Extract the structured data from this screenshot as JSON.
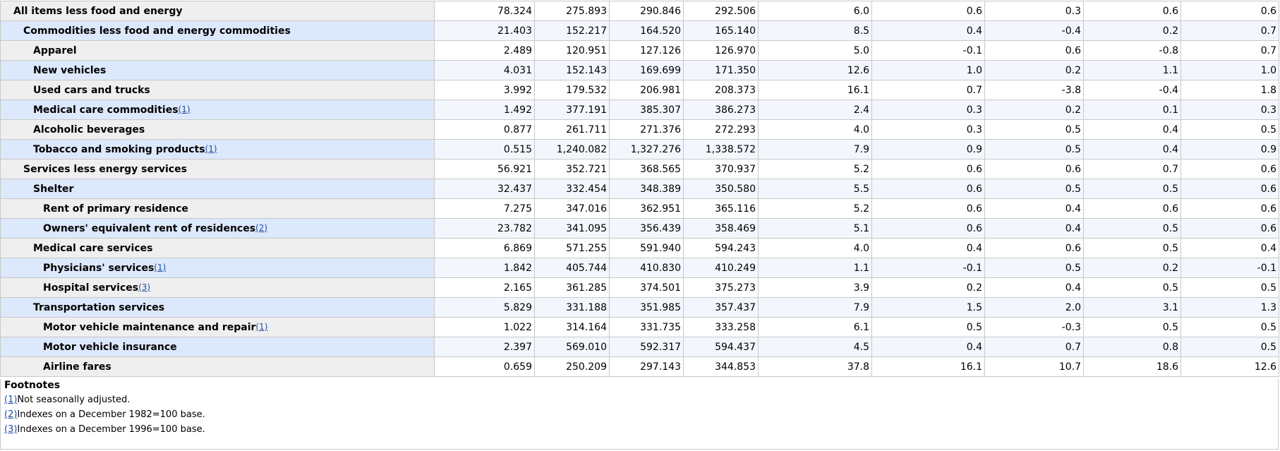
{
  "rows": [
    {
      "label": "All items less food and energy",
      "indent": 0,
      "fn": "",
      "values": [
        "78.324",
        "275.893",
        "290.846",
        "292.506",
        "6.0",
        "0.6",
        "0.3",
        "0.6",
        "0.6"
      ]
    },
    {
      "label": "Commodities less food and energy commodities",
      "indent": 1,
      "fn": "",
      "values": [
        "21.403",
        "152.217",
        "164.520",
        "165.140",
        "8.5",
        "0.4",
        "-0.4",
        "0.2",
        "0.7"
      ]
    },
    {
      "label": "Apparel",
      "indent": 2,
      "fn": "",
      "values": [
        "2.489",
        "120.951",
        "127.126",
        "126.970",
        "5.0",
        "-0.1",
        "0.6",
        "-0.8",
        "0.7"
      ]
    },
    {
      "label": "New vehicles",
      "indent": 2,
      "fn": "",
      "values": [
        "4.031",
        "152.143",
        "169.699",
        "171.350",
        "12.6",
        "1.0",
        "0.2",
        "1.1",
        "1.0"
      ]
    },
    {
      "label": "Used cars and trucks",
      "indent": 2,
      "fn": "",
      "values": [
        "3.992",
        "179.532",
        "206.981",
        "208.373",
        "16.1",
        "0.7",
        "-3.8",
        "-0.4",
        "1.8"
      ]
    },
    {
      "label": "Medical care commodities",
      "indent": 2,
      "fn": "(1)",
      "values": [
        "1.492",
        "377.191",
        "385.307",
        "386.273",
        "2.4",
        "0.3",
        "0.2",
        "0.1",
        "0.3"
      ]
    },
    {
      "label": "Alcoholic beverages",
      "indent": 2,
      "fn": "",
      "values": [
        "0.877",
        "261.711",
        "271.376",
        "272.293",
        "4.0",
        "0.3",
        "0.5",
        "0.4",
        "0.5"
      ]
    },
    {
      "label": "Tobacco and smoking products",
      "indent": 2,
      "fn": "(1)",
      "values": [
        "0.515",
        "1,240.082",
        "1,327.276",
        "1,338.572",
        "7.9",
        "0.9",
        "0.5",
        "0.4",
        "0.9"
      ]
    },
    {
      "label": "Services less energy services",
      "indent": 1,
      "fn": "",
      "values": [
        "56.921",
        "352.721",
        "368.565",
        "370.937",
        "5.2",
        "0.6",
        "0.6",
        "0.7",
        "0.6"
      ]
    },
    {
      "label": "Shelter",
      "indent": 2,
      "fn": "",
      "values": [
        "32.437",
        "332.454",
        "348.389",
        "350.580",
        "5.5",
        "0.6",
        "0.5",
        "0.5",
        "0.6"
      ]
    },
    {
      "label": "Rent of primary residence",
      "indent": 3,
      "fn": "",
      "values": [
        "7.275",
        "347.016",
        "362.951",
        "365.116",
        "5.2",
        "0.6",
        "0.4",
        "0.6",
        "0.6"
      ]
    },
    {
      "label": "Owners' equivalent rent of residences",
      "indent": 3,
      "fn": "(2)",
      "values": [
        "23.782",
        "341.095",
        "356.439",
        "358.469",
        "5.1",
        "0.6",
        "0.4",
        "0.5",
        "0.6"
      ]
    },
    {
      "label": "Medical care services",
      "indent": 2,
      "fn": "",
      "values": [
        "6.869",
        "571.255",
        "591.940",
        "594.243",
        "4.0",
        "0.4",
        "0.6",
        "0.5",
        "0.4"
      ]
    },
    {
      "label": "Physicians' services",
      "indent": 3,
      "fn": "(1)",
      "values": [
        "1.842",
        "405.744",
        "410.830",
        "410.249",
        "1.1",
        "-0.1",
        "0.5",
        "0.2",
        "-0.1"
      ]
    },
    {
      "label": "Hospital services",
      "indent": 3,
      "fn": "(3)",
      "values": [
        "2.165",
        "361.285",
        "374.501",
        "375.273",
        "3.9",
        "0.2",
        "0.4",
        "0.5",
        "0.5"
      ]
    },
    {
      "label": "Transportation services",
      "indent": 2,
      "fn": "",
      "values": [
        "5.829",
        "331.188",
        "351.985",
        "357.437",
        "7.9",
        "1.5",
        "2.0",
        "3.1",
        "1.3"
      ]
    },
    {
      "label": "Motor vehicle maintenance and repair",
      "indent": 3,
      "fn": "(1)",
      "values": [
        "1.022",
        "314.164",
        "331.735",
        "333.258",
        "6.1",
        "0.5",
        "-0.3",
        "0.5",
        "0.5"
      ]
    },
    {
      "label": "Motor vehicle insurance",
      "indent": 3,
      "fn": "",
      "values": [
        "2.397",
        "569.010",
        "592.317",
        "594.437",
        "4.5",
        "0.4",
        "0.7",
        "0.8",
        "0.5"
      ]
    },
    {
      "label": "Airline fares",
      "indent": 3,
      "fn": "",
      "values": [
        "0.659",
        "250.209",
        "297.143",
        "344.853",
        "37.8",
        "16.1",
        "10.7",
        "18.6",
        "12.6"
      ]
    }
  ],
  "footnotes": {
    "heading": "Footnotes",
    "items": [
      {
        "num": "(1)",
        "text": "Not seasonally adjusted."
      },
      {
        "num": "(2)",
        "text": "Indexes on a December 1982=100 base."
      },
      {
        "num": "(3)",
        "text": "Indexes on a December 1996=100 base."
      }
    ]
  }
}
